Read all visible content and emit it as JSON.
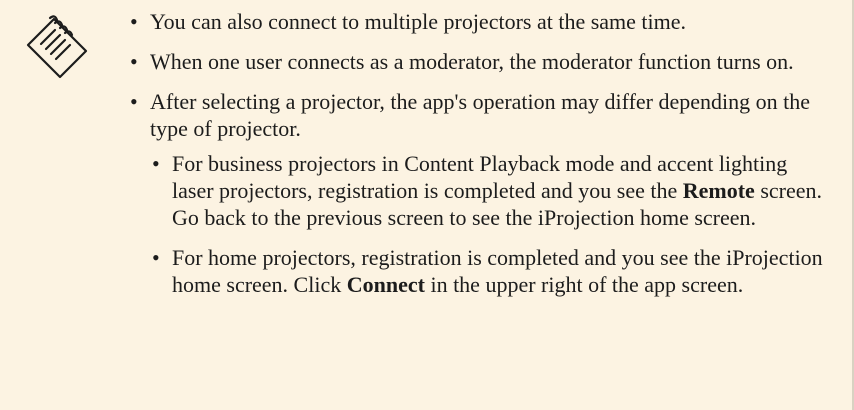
{
  "note": {
    "icon": "note-pad-icon",
    "items": [
      {
        "text": "You can also connect to multiple projectors at the same time."
      },
      {
        "text": "When one user connects as a moderator, the moderator function turns on."
      },
      {
        "text": "After selecting a projector, the app's operation may differ depending on the type of projector.",
        "sub_items": [
          {
            "pre": "For business projectors in Content Playback mode and accent lighting laser projectors, registration is completed and you see the ",
            "bold": "Remote",
            "post": " screen. Go back to the previous screen to see the iProjection home screen."
          },
          {
            "pre": "For home projectors, registration is completed and you see the iProjection home screen. Click ",
            "bold": "Connect",
            "post": " in the upper right of the app screen."
          }
        ]
      }
    ]
  }
}
